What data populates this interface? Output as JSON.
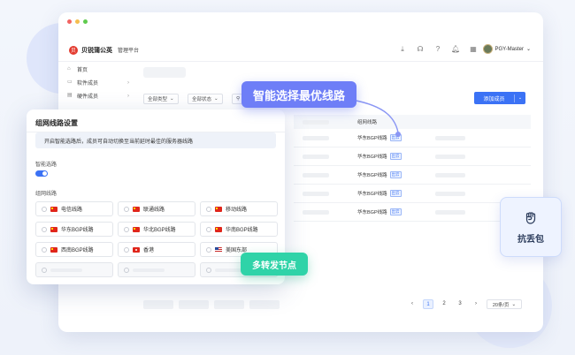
{
  "app": {
    "brand": "贝锐蒲公英",
    "subtitle": "管理平台",
    "logo_char": "贝"
  },
  "user": {
    "name": "PGY-Master"
  },
  "sidebar": {
    "items": [
      {
        "label": "首页",
        "has_arrow": false
      },
      {
        "label": "软件成员",
        "has_arrow": true
      },
      {
        "label": "硬件成员",
        "has_arrow": true
      }
    ]
  },
  "filters": {
    "type": "全部类型",
    "status": "全部状态"
  },
  "add_button": {
    "label": "添加成员"
  },
  "table": {
    "route_header": "组网线路",
    "rows": [
      {
        "route": "华东BGP线路",
        "tag": "出云"
      },
      {
        "route": "华东BGP线路",
        "tag": "出云"
      },
      {
        "route": "华东BGP线路",
        "tag": "出云"
      },
      {
        "route": "华东BGP线路",
        "tag": "出云"
      },
      {
        "route": "华东BGP线路",
        "tag": "出云"
      }
    ]
  },
  "pagination": {
    "pages": [
      "1",
      "2",
      "3"
    ],
    "active": "1",
    "page_size": "20条/页"
  },
  "panel": {
    "title": "组网线路设置",
    "notice": "开启智能选路后，成员可自动切换至当前延时最佳的服务器线路",
    "smart_label": "智能选路",
    "smart_enabled": true,
    "lines_label": "组网线路",
    "lines": [
      {
        "name": "电信线路",
        "flag": "cn"
      },
      {
        "name": "联通线路",
        "flag": "cn"
      },
      {
        "name": "移动线路",
        "flag": "cn"
      },
      {
        "name": "华东BGP线路",
        "flag": "cn"
      },
      {
        "name": "华北BGP线路",
        "flag": "cn"
      },
      {
        "name": "华南BGP线路",
        "flag": "cn"
      },
      {
        "name": "西南BGP线路",
        "flag": "cn"
      },
      {
        "name": "香港",
        "flag": "hk"
      },
      {
        "name": "美国东部",
        "flag": "us"
      }
    ]
  },
  "callouts": {
    "smart_route": "智能选择最优线路",
    "relay": "多转发节点",
    "anti_loss": "抗丢包"
  },
  "colors": {
    "primary": "#3b72f5",
    "callout_purple": "#6e7ef7",
    "callout_green": "#2fd3a8"
  }
}
